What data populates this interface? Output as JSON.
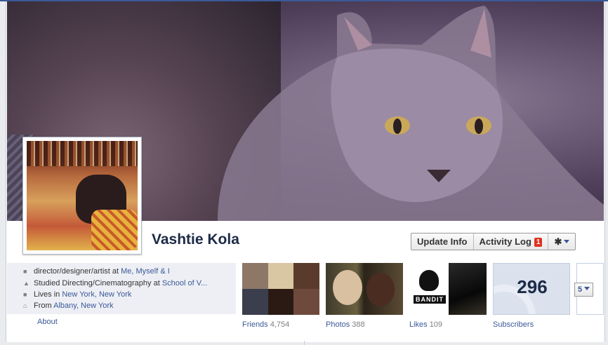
{
  "profile": {
    "name": "Vashtie Kola",
    "buttons": {
      "update_info": "Update Info",
      "activity_log": "Activity Log",
      "activity_badge": "1"
    }
  },
  "info": {
    "work": {
      "prefix": "director/designer/artist at ",
      "link": "Me, Myself & I"
    },
    "education": {
      "prefix": "Studied Directing/Cinematography at ",
      "link": "School of V..."
    },
    "lives": {
      "prefix": "Lives in ",
      "link": "New York, New York"
    },
    "from": {
      "prefix": "From ",
      "link": "Albany, New York"
    },
    "about_label": "About"
  },
  "tiles": {
    "friends": {
      "label": "Friends",
      "count": "4,754"
    },
    "photos": {
      "label": "Photos",
      "count": "388"
    },
    "likes": {
      "label": "Likes",
      "count": "109",
      "logo_text": "BANDIT"
    },
    "subscribers": {
      "label": "Subscribers",
      "count": "296"
    }
  },
  "more": {
    "label": "5"
  },
  "colors": {
    "link": "#3b5998",
    "name": "#1c2a47",
    "badge": "#e0311f",
    "info_bg": "#edeff4"
  },
  "icons": [
    "briefcase-icon",
    "school-icon",
    "home-icon",
    "hometown-icon",
    "gear-icon",
    "chevron-down-icon"
  ]
}
